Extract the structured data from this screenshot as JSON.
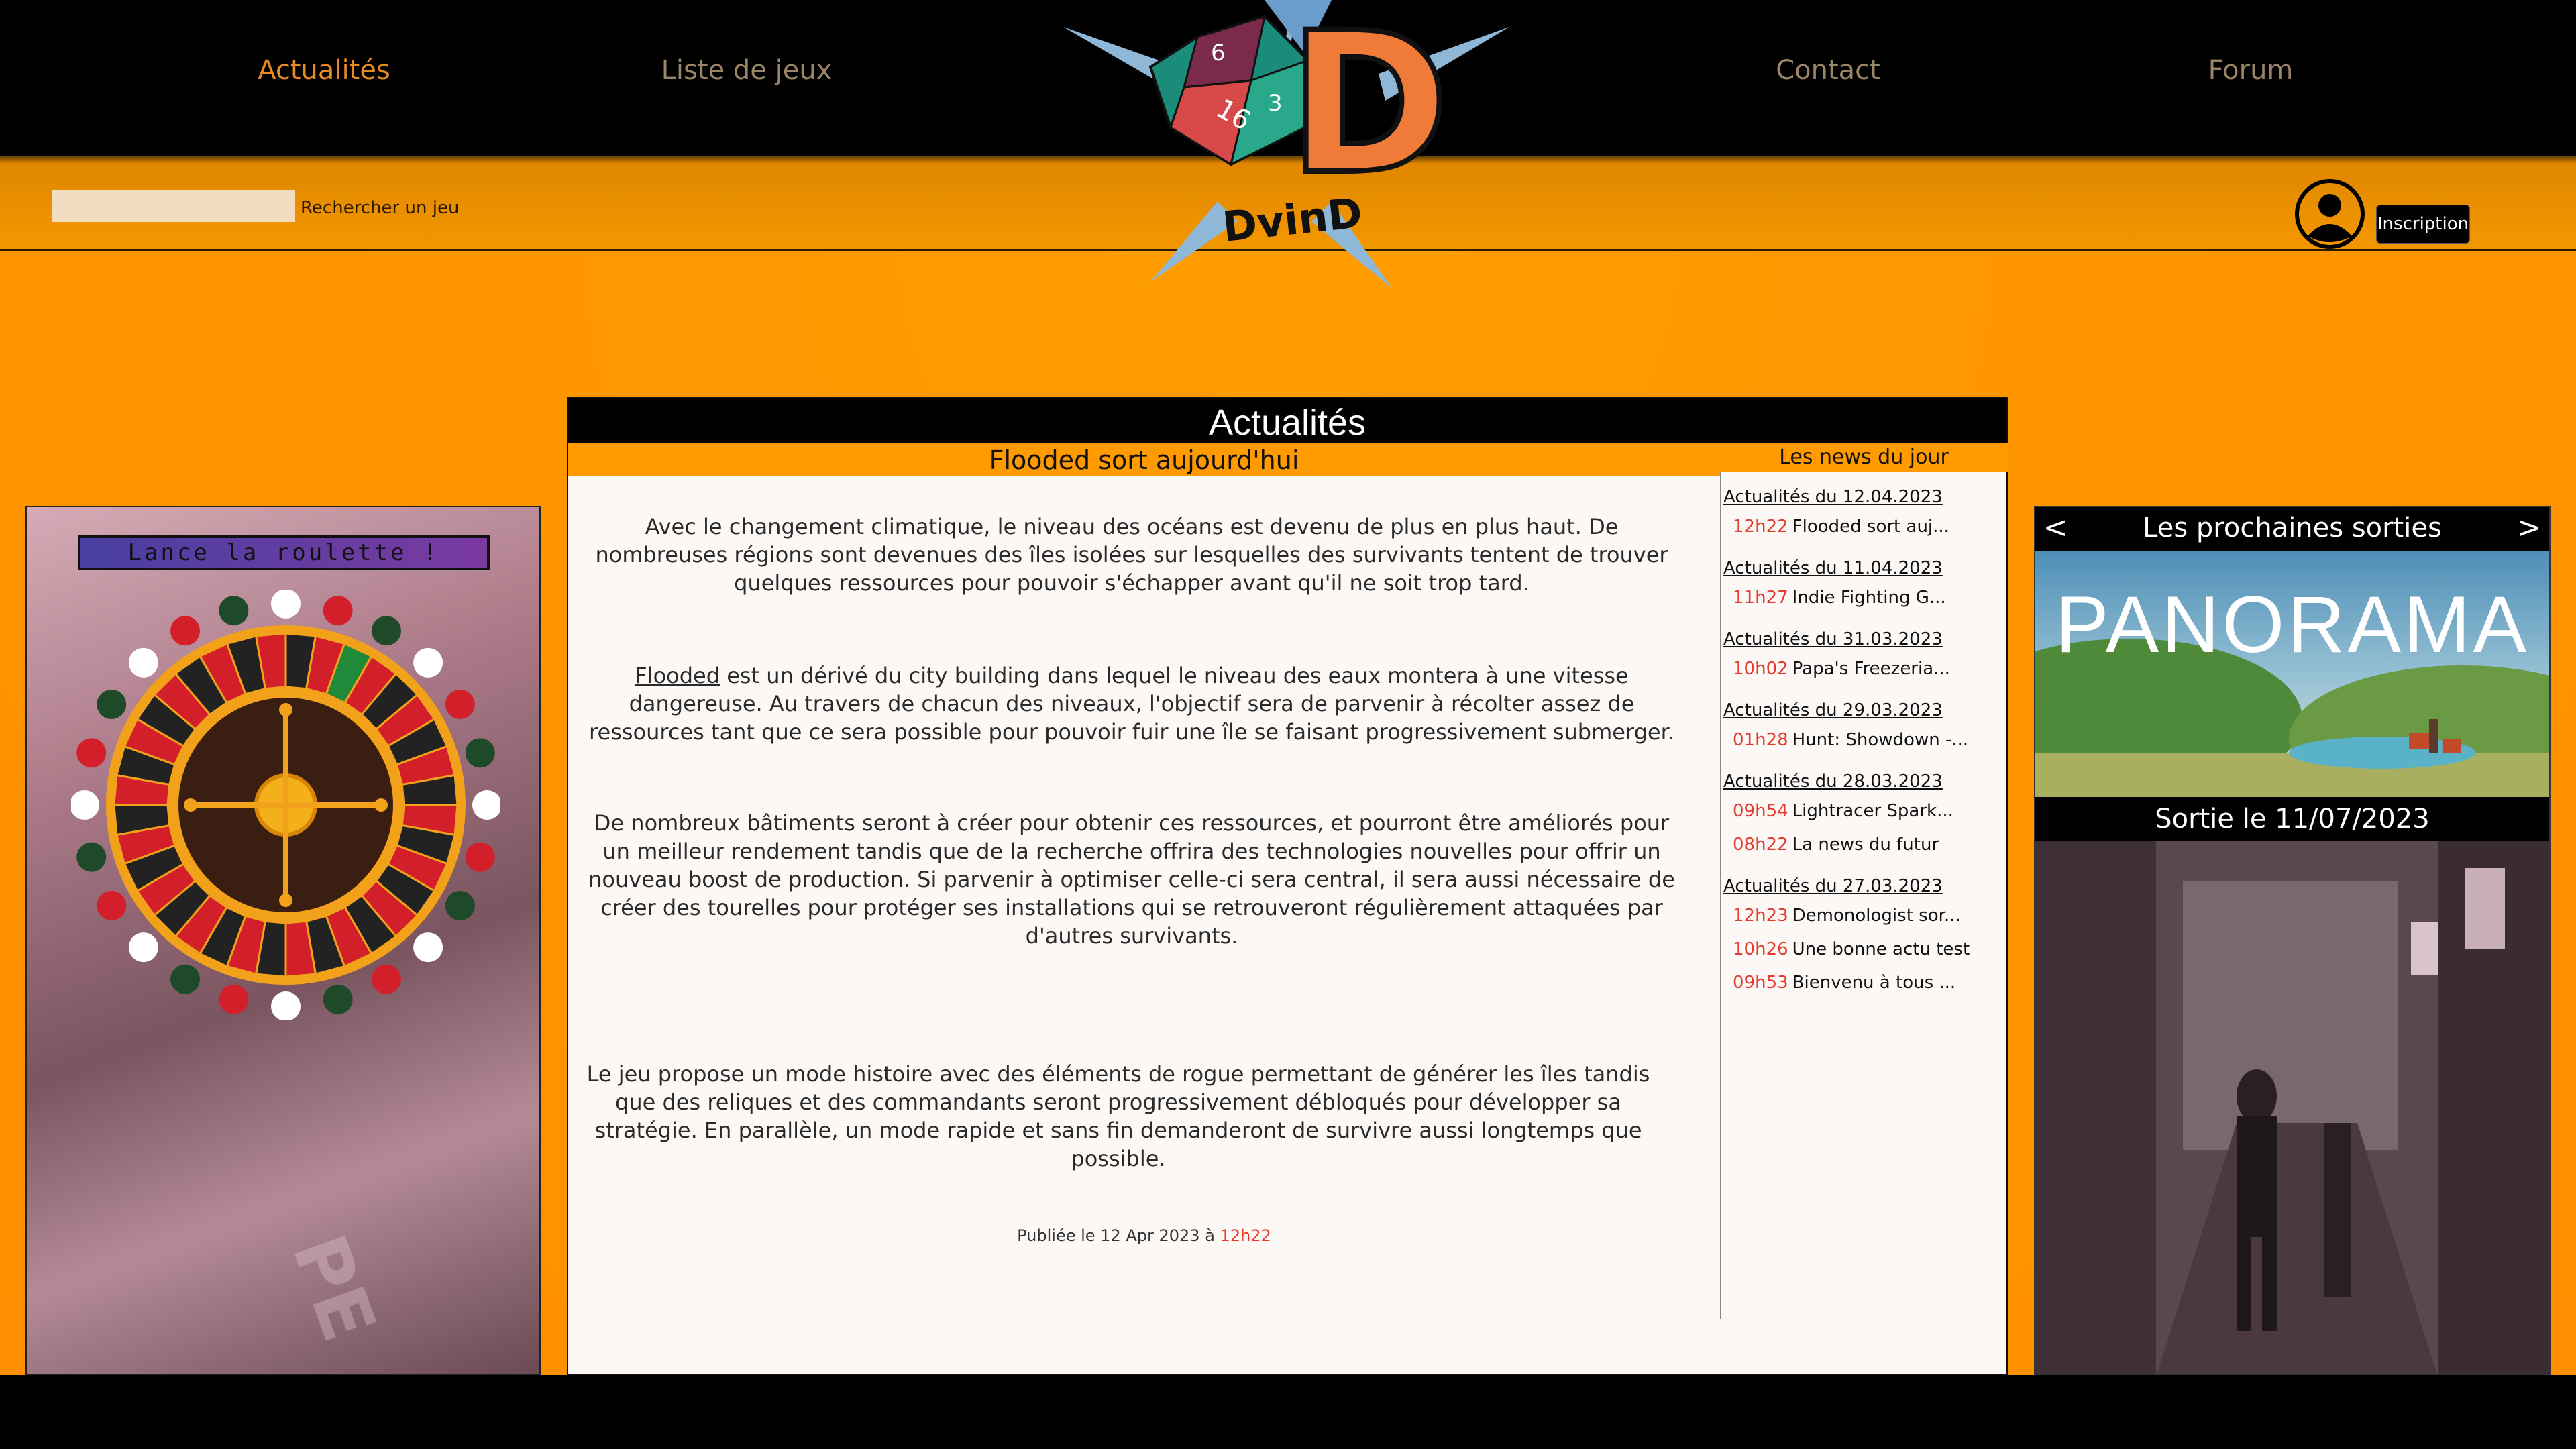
{
  "nav": {
    "items": [
      {
        "label": "Actualités"
      },
      {
        "label": "Liste de jeux"
      },
      {
        "label": "Contact"
      },
      {
        "label": "Forum"
      }
    ]
  },
  "logo": {
    "text": "DvinD",
    "letter": "D"
  },
  "search": {
    "value": "",
    "label": "Rechercher un jeu"
  },
  "account": {
    "signup_label": "Inscription"
  },
  "main": {
    "header": "Actualités",
    "article_title": "Flooded sort aujourd'hui",
    "paragraphs": [
      "Avec le changement climatique, le niveau des océans est devenu de plus en plus haut. De nombreuses régions sont devenues des îles isolées sur lesquelles des survivants tentent de trouver quelques ressources pour pouvoir s'échapper avant qu'il ne soit trop tard.",
      "est un dérivé du city building dans lequel le niveau des eaux montera à une vitesse dangereuse. Au travers de chacun des niveaux, l'objectif sera de parvenir à récolter assez de ressources tant que ce sera possible pour pouvoir fuir une île se faisant progressivement submerger.",
      "De nombreux bâtiments seront à créer pour obtenir ces ressources, et pourront être améliorés pour un meilleur rendement tandis que de la recherche offrira des technologies nouvelles pour offrir un nouveau boost de production. Si parvenir à optimiser celle-ci sera central, il sera aussi nécessaire de créer des tourelles pour protéger ses installations qui se retrouveront régulièrement attaquées par d'autres survivants.",
      "Le jeu propose un mode histoire avec des éléments de rogue permettant de générer les îles tandis que des reliques et des commandants seront progressivement débloqués pour développer sa stratégie. En parallèle, un mode rapide et sans fin demanderont de survivre aussi longtemps que possible."
    ],
    "game_link": "Flooded",
    "published_prefix": "Publiée le 12 Apr 2023 à",
    "published_time": "12h22"
  },
  "news": {
    "title": "Les news du jour",
    "groups": [
      {
        "date": "Actualités du 12.04.2023",
        "items": [
          {
            "time": "12h22",
            "text": "Flooded sort auj..."
          }
        ]
      },
      {
        "date": "Actualités du 11.04.2023",
        "items": [
          {
            "time": "11h27",
            "text": "Indie Fighting G..."
          }
        ]
      },
      {
        "date": "Actualités du 31.03.2023",
        "items": [
          {
            "time": "10h02",
            "text": "Papa's Freezeria..."
          }
        ]
      },
      {
        "date": "Actualités du 29.03.2023",
        "items": [
          {
            "time": "01h28",
            "text": "Hunt: Showdown -..."
          }
        ]
      },
      {
        "date": "Actualités du 28.03.2023",
        "items": [
          {
            "time": "09h54",
            "text": "Lightracer Spark..."
          },
          {
            "time": "08h22",
            "text": "La news du futur"
          }
        ]
      },
      {
        "date": "Actualités du 27.03.2023",
        "items": [
          {
            "time": "12h23",
            "text": "Demonologist sor..."
          },
          {
            "time": "10h26",
            "text": "Une bonne actu test"
          },
          {
            "time": "09h53",
            "text": "Bienvenu à tous ..."
          }
        ]
      }
    ]
  },
  "roulette": {
    "button_label": "Lance la roulette !"
  },
  "releases": {
    "title": "Les prochaines sorties",
    "prev": "<",
    "next": ">",
    "game_title": "PANORAMA",
    "release_date": "Sortie le 11/07/2023"
  },
  "colors": {
    "accent": "#ff9a00",
    "time_red": "#e53b2c",
    "nav_active": "#e78a22",
    "nav_inactive": "#9a8566"
  }
}
